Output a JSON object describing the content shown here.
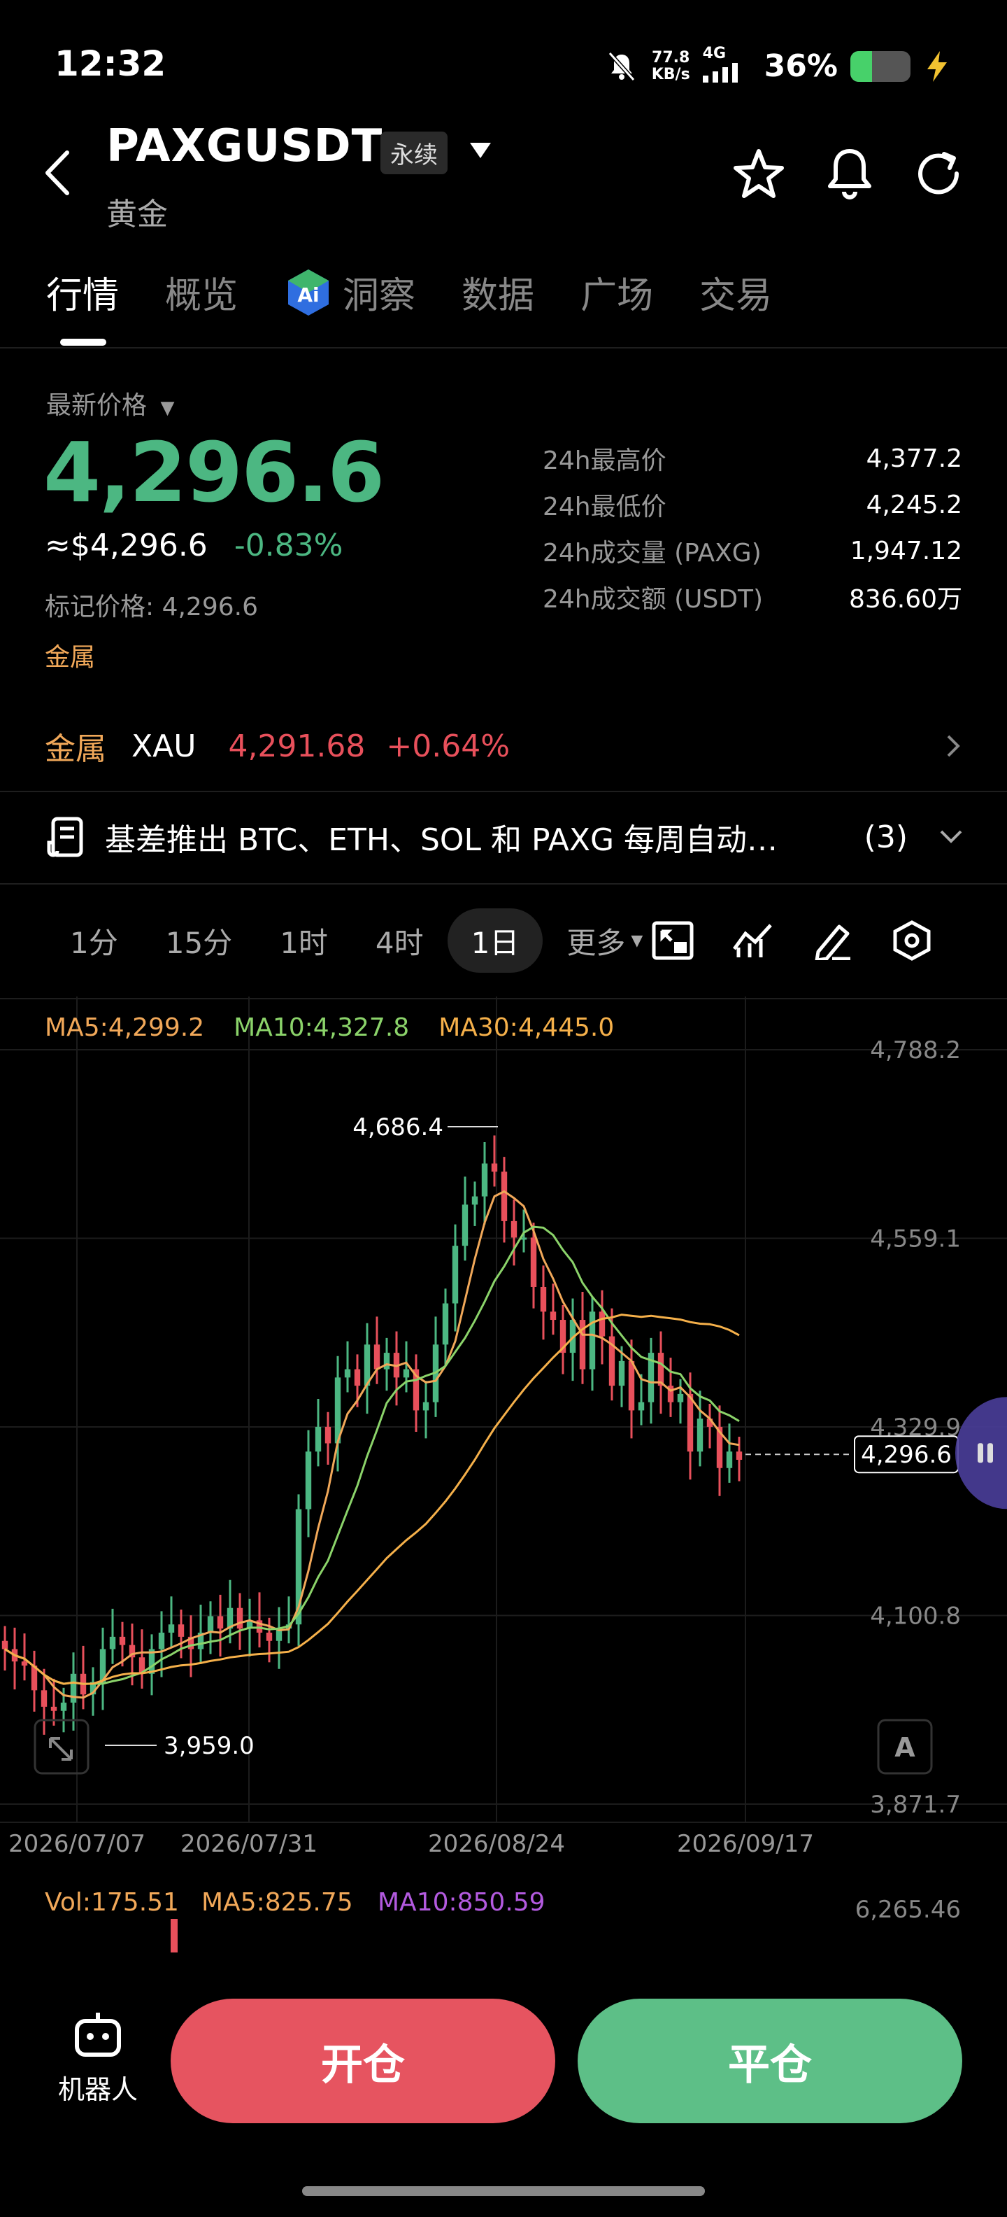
{
  "status": {
    "time": "12:32",
    "speed_value": "77.8",
    "speed_unit": "KB/s",
    "net": "4G",
    "battery": "36%",
    "battery_level": 0.36
  },
  "header": {
    "symbol": "PAXGUSDT",
    "badge": "永续",
    "subtitle": "黄金",
    "icons": [
      "back-icon",
      "dropdown-icon",
      "star-icon",
      "bell-icon",
      "share-icon"
    ]
  },
  "tabs": [
    "行情",
    "概览",
    "洞察",
    "数据",
    "广场",
    "交易"
  ],
  "price": {
    "label": "最新价格",
    "value": "4,296.6",
    "usd": "≈$4,296.6",
    "change": "-0.83%",
    "mark": "标记价格: 4,296.6",
    "tag": "金属"
  },
  "stats": [
    {
      "k": "24h最高价",
      "v": "4,377.2"
    },
    {
      "k": "24h最低价",
      "v": "4,245.2"
    },
    {
      "k": "24h成交量 (PAXG)",
      "v": "1,947.12"
    },
    {
      "k": "24h成交额 (USDT)",
      "v": "836.60万"
    }
  ],
  "metal": {
    "category": "金属",
    "code": "XAU",
    "price": "4,291.68",
    "change": "+0.64%"
  },
  "news": {
    "text": "基差推出 BTC、ETH、SOL 和 PAXG 每周自动…",
    "count": "(3)"
  },
  "timeframes": [
    "1分",
    "15分",
    "1时",
    "4时",
    "1日",
    "更多"
  ],
  "active_timeframe": "1日",
  "ma_legend": {
    "ma5": "MA5:4,299.2",
    "ma10": "MA10:4,327.8",
    "ma30": "MA30:4,445.0"
  },
  "colors": {
    "up": "#4cb782",
    "down": "#e8505b",
    "ma5": "#f1a859",
    "ma10": "#8bd36a",
    "ma30": "#f5b04a",
    "vol_ma10": "#b35adf"
  },
  "chart_data": {
    "type": "candlestick",
    "y_ticks": [
      "4,788.2",
      "4,559.1",
      "4,329.9",
      "4,100.8",
      "3,871.7"
    ],
    "ylim": [
      3871.7,
      4788.2
    ],
    "x_ticks": [
      "2026/07/07",
      "2026/07/31",
      "2026/08/24",
      "2026/09/17"
    ],
    "high_label": "4,686.4",
    "low_label": "3,959.0",
    "last_price_label": "4,296.6",
    "closes": [
      4060,
      4045,
      4040,
      4010,
      3990,
      3985,
      3995,
      4030,
      4005,
      4020,
      4060,
      4075,
      4065,
      4050,
      4030,
      4060,
      4080,
      4090,
      4075,
      4060,
      4080,
      4100,
      4085,
      4110,
      4085,
      4095,
      4080,
      4070,
      4085,
      4090,
      4230,
      4300,
      4330,
      4310,
      4390,
      4400,
      4380,
      4430,
      4400,
      4420,
      4390,
      4400,
      4350,
      4360,
      4430,
      4480,
      4550,
      4600,
      4610,
      4650,
      4640,
      4580,
      4560,
      4560,
      4500,
      4470,
      4460,
      4420,
      4460,
      4400,
      4470,
      4440,
      4380,
      4410,
      4350,
      4360,
      4420,
      4380,
      4360,
      4370,
      4300,
      4340,
      4330,
      4280,
      4300,
      4290
    ],
    "volume": {
      "vol": "Vol:175.51",
      "ma5": "MA5:825.75",
      "ma10": "MA10:850.59",
      "max": "6,265.46"
    }
  },
  "bottom": {
    "robot": "机器人",
    "open": "开仓",
    "close": "平仓"
  },
  "overlay_badge": "A"
}
